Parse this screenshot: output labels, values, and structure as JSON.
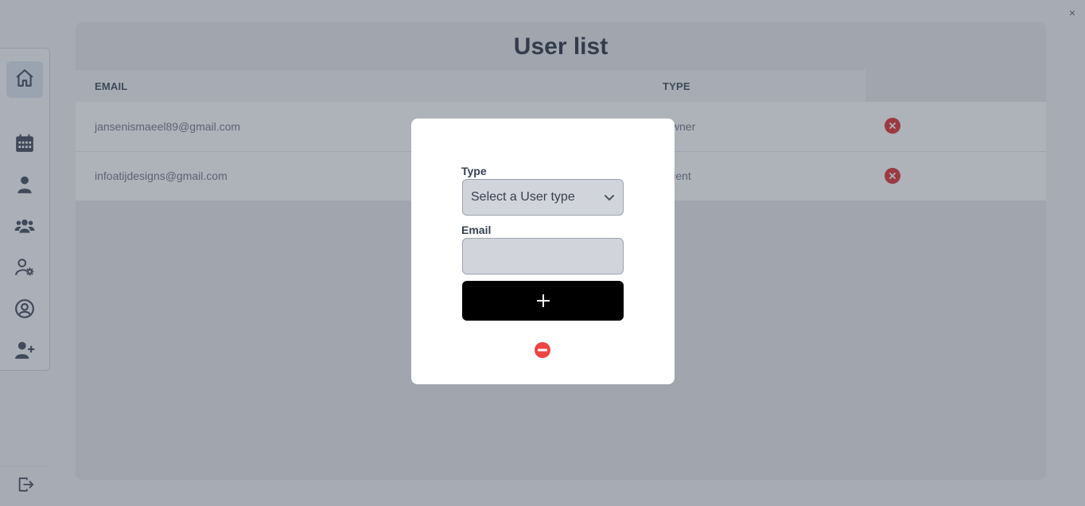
{
  "window": {
    "close_glyph": "×"
  },
  "sidebar": {
    "items": [
      {
        "icon": "home-icon",
        "active": true
      },
      {
        "icon": "calendar-icon",
        "active": false
      },
      {
        "icon": "user-icon",
        "active": false
      },
      {
        "icon": "users-icon",
        "active": false
      },
      {
        "icon": "user-gear-icon",
        "active": false
      },
      {
        "icon": "user-circle-icon",
        "active": false
      },
      {
        "icon": "user-plus-icon",
        "active": false
      }
    ],
    "logout_icon": "logout-icon"
  },
  "main": {
    "title": "User list",
    "columns": {
      "email": "EMAIL",
      "type": "TYPE"
    },
    "rows": [
      {
        "email": "jansenismaeel89@gmail.com",
        "type": "Owner"
      },
      {
        "email": "infoatijdesigns@gmail.com",
        "type": "Client"
      }
    ]
  },
  "modal": {
    "type_label": "Type",
    "type_placeholder": "Select a User type",
    "email_label": "Email",
    "email_value": "",
    "add_glyph": "+",
    "close_icon": "minus-circle-icon"
  },
  "colors": {
    "accent_black": "#000000",
    "delete_red": "#dc2626",
    "close_red": "#ef4444"
  }
}
